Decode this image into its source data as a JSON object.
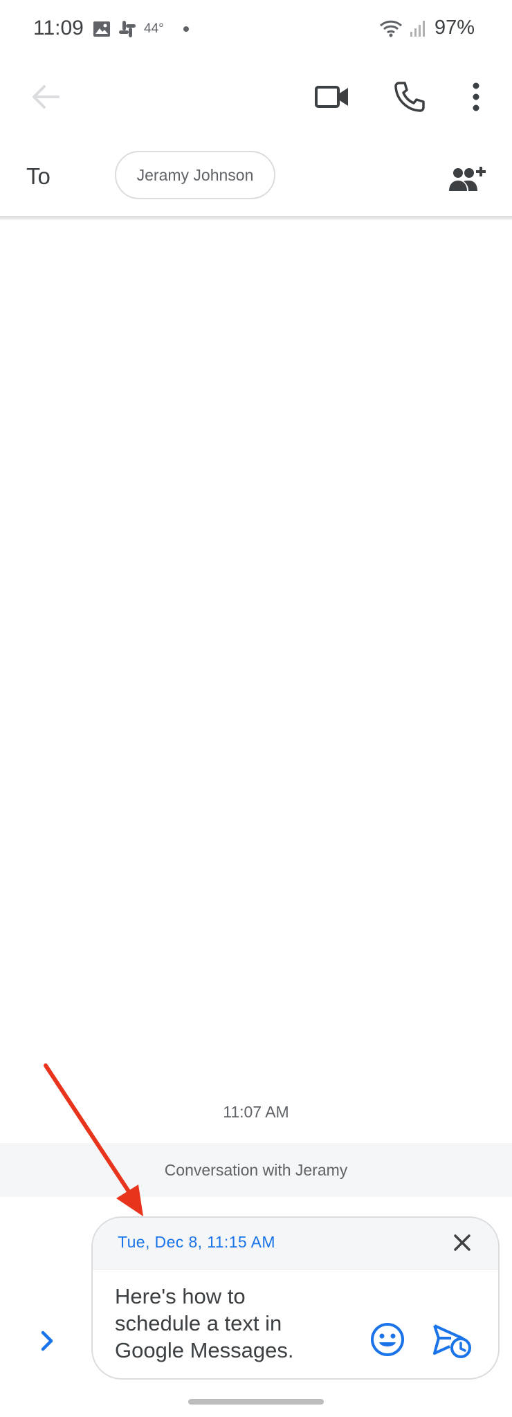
{
  "status_bar": {
    "time": "11:09",
    "temperature": "44°",
    "battery": "97%",
    "icons": [
      "image-icon",
      "slack-icon",
      "notification-dot",
      "wifi-icon",
      "signal-icon"
    ]
  },
  "app_bar": {
    "icons": [
      "back-arrow-icon",
      "video-call-icon",
      "phone-icon",
      "more-vert-icon"
    ]
  },
  "recipient": {
    "to_label": "To",
    "contact_chip": "Jeramy Johnson",
    "add_icon": "add-people-icon"
  },
  "conversation": {
    "timestamp": "11:07 AM",
    "banner": "Conversation with Jeramy"
  },
  "compose": {
    "scheduled_time": "Tue, Dec 8, 11:15 AM",
    "message_lines": [
      "Here's how to",
      "schedule a text in",
      "Google Messages."
    ],
    "icons": [
      "chevron-right-icon",
      "close-icon",
      "emoji-icon",
      "scheduled-send-icon"
    ]
  },
  "colors": {
    "accent": "#1a73e8",
    "annotation": "#e8341c",
    "text": "#3c4043",
    "secondary_text": "#5f6368",
    "banner_bg": "#f5f6f7"
  }
}
